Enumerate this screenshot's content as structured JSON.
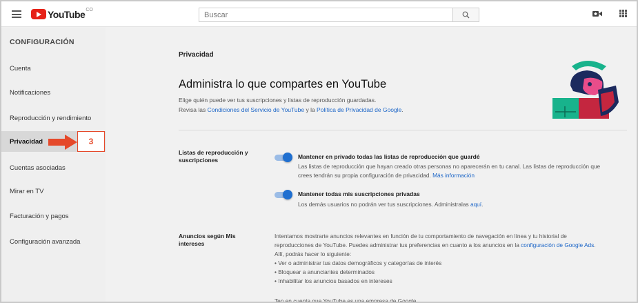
{
  "header": {
    "logo_text": "YouTube",
    "logo_suffix": "CO",
    "search_placeholder": "Buscar",
    "icons": [
      "menu-icon",
      "search-icon",
      "video-camera-icon",
      "apps-grid-icon"
    ]
  },
  "sidebar": {
    "heading": "CONFIGURACIÓN",
    "items": [
      {
        "label": "Cuenta",
        "active": false
      },
      {
        "label": "Notificaciones",
        "active": false
      },
      {
        "label": "Reproducción y rendimiento",
        "active": false
      },
      {
        "label": "Privacidad",
        "active": true
      },
      {
        "label": "Cuentas asociadas",
        "active": false
      },
      {
        "label": "Mirar en TV",
        "active": false
      },
      {
        "label": "Facturación y pagos",
        "active": false
      },
      {
        "label": "Configuración avanzada",
        "active": false
      }
    ]
  },
  "annotation": {
    "step_number": "3",
    "color": "#e5492a"
  },
  "main": {
    "page_title": "Privacidad",
    "headline": "Administra lo que compartes en YouTube",
    "intro_line1": "Elige quién puede ver tus suscripciones y listas de reproducción guardadas.",
    "intro_line2_prefix": "Revisa las ",
    "terms_link": "Condiciones del Servicio de YouTube",
    "intro_line2_mid": " y la ",
    "privacy_link": "Política de Privacidad de Google",
    "intro_line2_suffix": "."
  },
  "playlists_section": {
    "label": "Listas de reproducción y suscripciones",
    "option1": {
      "title": "Mantener en privado todas las listas de reproducción que guardé",
      "desc_line1": "Las listas de reproducción que hayan creado otras personas no aparecerán en tu canal. Las listas de reproducción que",
      "desc_line2_prefix": "crees tendrán su propia configuración de privacidad. ",
      "link": "Más información",
      "enabled": true
    },
    "option2": {
      "title": "Mantener todas mis suscripciones privadas",
      "desc_prefix": "Los demás usuarios no podrán ver tus suscripciones. Administralas ",
      "link": "aquí",
      "desc_suffix": ".",
      "enabled": true
    }
  },
  "ads_section": {
    "label": "Anuncios según Mis intereses",
    "line1": "Intentamos mostrarte anuncios relevantes en función de tu comportamiento de navegación en línea y tu historial de",
    "line2_prefix": "reproducciones de YouTube. Puedes administrar tus preferencias en cuanto a los anuncios en la ",
    "line2_link": "configuración de Google Ads",
    "line2_suffix": ".",
    "line3": "Allí, podrás hacer lo siguiente:",
    "bullets": [
      "• Ver o administrar tus datos demográficos y categorías de interés",
      "• Bloquear a anunciantes determinados",
      "• Inhabilitar los anuncios basados en intereses"
    ],
    "footer": "Ten en cuenta que YouTube es una empresa de Google."
  },
  "colors": {
    "brand_red": "#e62117",
    "link_blue": "#1b65c7",
    "toggle_blue": "#1f6fd0",
    "sidebar_bg": "#efefef",
    "active_bg": "#d8d8d8"
  }
}
